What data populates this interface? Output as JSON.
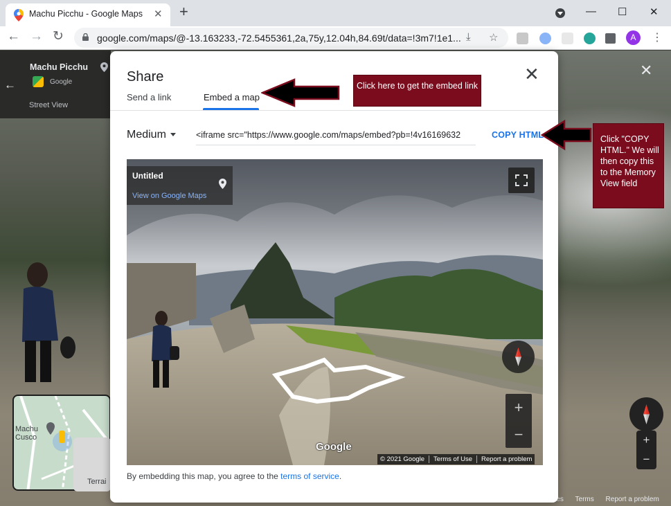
{
  "browser": {
    "tab_title": "Machu Picchu - Google Maps",
    "tab_close": "✕",
    "new_tab": "+",
    "win_min": "—",
    "win_max": "☐",
    "win_close": "✕",
    "back": "←",
    "forward": "→",
    "reload": "↻",
    "url": "google.com/maps/@-13.163233,-72.5455361,2a,75y,12.04h,84.69t/data=!3m7!1e1...",
    "avatar_letter": "A",
    "kebab": "⋮",
    "star": "☆"
  },
  "maps_bg": {
    "place_title": "Machu Picchu",
    "google_label": "Google",
    "street_view_label": "Street View",
    "back": "←",
    "close": "✕",
    "minimap_label_1": "Machu",
    "minimap_label_2": "Cusco",
    "terrain_label": "Terrai",
    "zoom_in": "+",
    "zoom_out": "−",
    "footer": [
      "res",
      "Terms",
      "Report a problem"
    ]
  },
  "dialog": {
    "title": "Share",
    "close": "✕",
    "tabs": [
      {
        "label": "Send a link",
        "active": false
      },
      {
        "label": "Embed a map",
        "active": true
      }
    ],
    "size_value": "Medium",
    "embed_code": "<iframe src=\"https://www.google.com/maps/embed?pb=!4v16169632",
    "copy_label": "COPY HTML",
    "preview": {
      "card_title": "Untitled",
      "card_link": "View on Google Maps",
      "zoom_in": "+",
      "zoom_out": "−",
      "watermark": "Google",
      "attribution": [
        "© 2021 Google",
        "Terms of Use",
        "Report a problem"
      ]
    },
    "terms_prefix": "By embedding this map, you agree to the ",
    "terms_link": "terms of service",
    "terms_suffix": "."
  },
  "annotations": {
    "note1": "Click here to get the embed link",
    "note2": "Click \"COPY HTML.\" We will then copy this to the Memory View field"
  },
  "colors": {
    "accent": "#1a73e8",
    "annotation": "#7b0c1e"
  }
}
